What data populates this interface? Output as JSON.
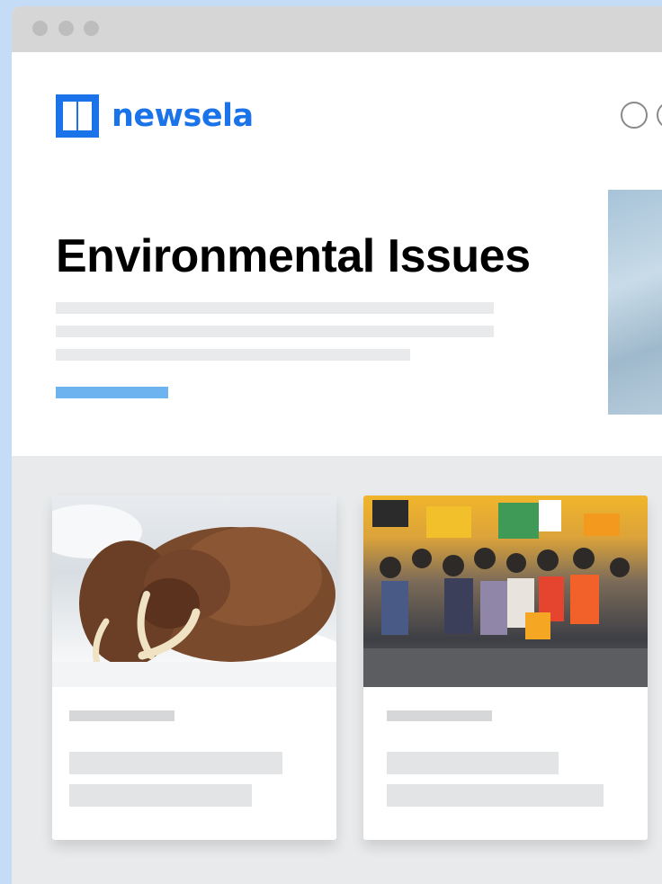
{
  "brand": {
    "name": "newsela",
    "color": "#1a73e8",
    "icon": "newsela-book-icon"
  },
  "hero": {
    "title": "Environmental Issues",
    "accent_color": "#6cb3f0"
  },
  "cards": [
    {
      "image": "walrus-photo"
    },
    {
      "image": "climate-march-photo"
    }
  ]
}
